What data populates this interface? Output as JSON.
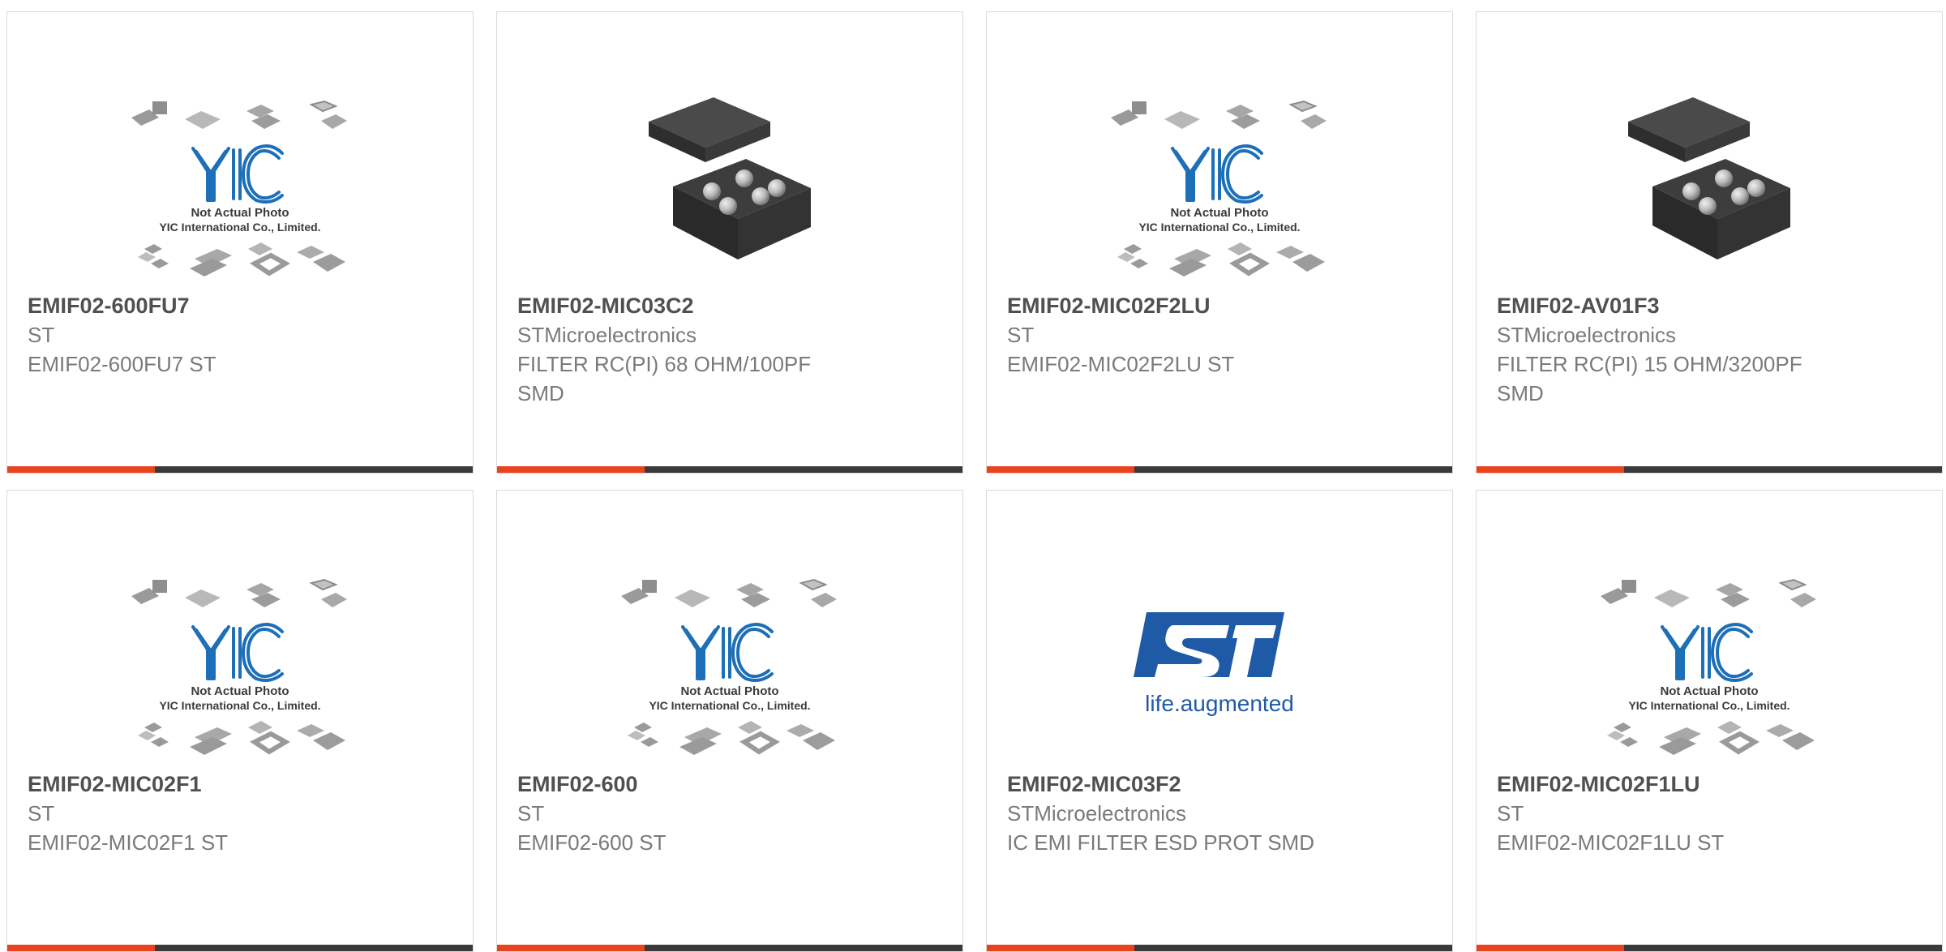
{
  "cards": [
    {
      "part": "EMIF02-600FU7",
      "manufacturer": "ST",
      "description": "EMIF02-600FU7 ST",
      "image": "yic-not-actual-photo",
      "image_caption_1": "Not Actual Photo",
      "image_caption_2": "YIC International Co., Limited."
    },
    {
      "part": "EMIF02-MIC03C2",
      "manufacturer": "STMicroelectronics",
      "description": "FILTER RC(PI) 68 OHM/100PF\nSMD",
      "image": "bga-chip-photo"
    },
    {
      "part": "EMIF02-MIC02F2LU",
      "manufacturer": "ST",
      "description": "EMIF02-MIC02F2LU ST",
      "image": "yic-not-actual-photo",
      "image_caption_1": "Not Actual Photo",
      "image_caption_2": "YIC International Co., Limited."
    },
    {
      "part": "EMIF02-AV01F3",
      "manufacturer": "STMicroelectronics",
      "description": "FILTER RC(PI) 15 OHM/3200PF\nSMD",
      "image": "bga-chip-photo"
    },
    {
      "part": "EMIF02-MIC02F1",
      "manufacturer": "ST",
      "description": "EMIF02-MIC02F1 ST",
      "image": "yic-not-actual-photo",
      "image_caption_1": "Not Actual Photo",
      "image_caption_2": "YIC International Co., Limited."
    },
    {
      "part": "EMIF02-600",
      "manufacturer": "ST",
      "description": "EMIF02-600 ST",
      "image": "yic-not-actual-photo",
      "image_caption_1": "Not Actual Photo",
      "image_caption_2": "YIC International Co., Limited."
    },
    {
      "part": "EMIF02-MIC03F2",
      "manufacturer": "STMicroelectronics",
      "description": "IC EMI FILTER ESD PROT SMD",
      "image": "st-logo",
      "logo_tagline": "life.augmented"
    },
    {
      "part": "EMIF02-MIC02F1LU",
      "manufacturer": "ST",
      "description": "EMIF02-MIC02F1LU ST",
      "image": "yic-not-actual-photo",
      "image_caption_1": "Not Actual Photo",
      "image_caption_2": "YIC International Co., Limited."
    }
  ],
  "colors": {
    "accent": "#e8431c",
    "bar": "#3a3a3a",
    "border": "#dadada",
    "part_text": "#505050",
    "body_text": "#7a7a7a",
    "yic_blue": "#1d6fb8",
    "st_blue": "#1f5aa6"
  }
}
